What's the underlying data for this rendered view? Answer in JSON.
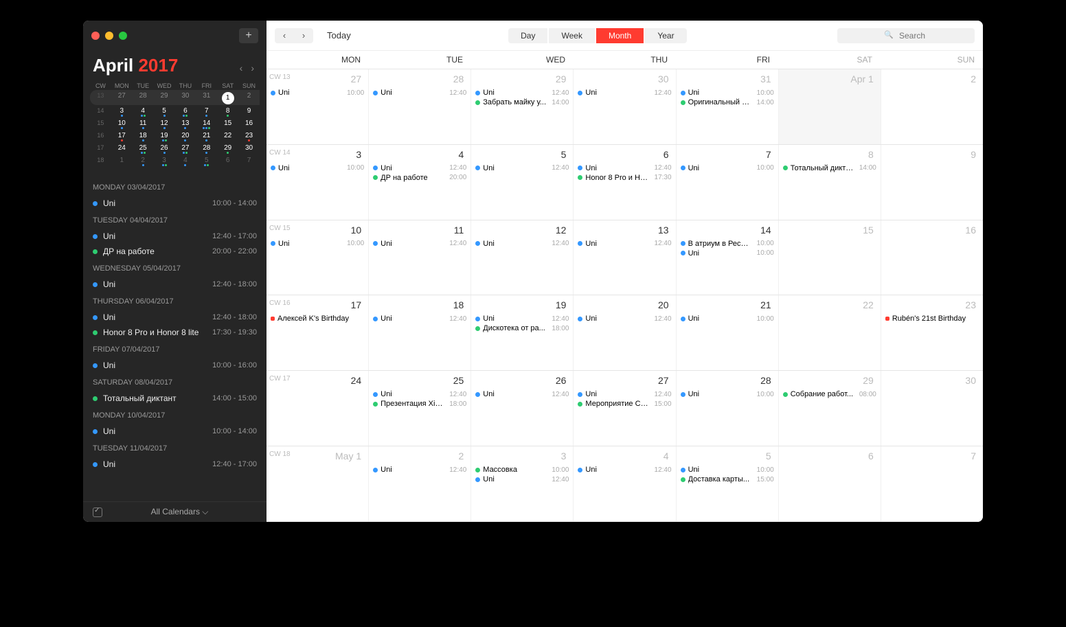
{
  "sidebar": {
    "month": "April",
    "year": "2017",
    "plus": "+",
    "dowHeaders": [
      "CW",
      "MON",
      "TUE",
      "WED",
      "THU",
      "FRI",
      "SAT",
      "SUN"
    ],
    "miniRows": [
      {
        "cw": "13",
        "days": [
          "27",
          "28",
          "29",
          "30",
          "31",
          "1",
          "2"
        ],
        "past": true,
        "todayIdx": 5
      },
      {
        "cw": "14",
        "days": [
          "3",
          "4",
          "5",
          "6",
          "7",
          "8",
          "9"
        ],
        "dots": [
          [
            "b"
          ],
          [
            "b",
            "g"
          ],
          [
            "b"
          ],
          [
            "b",
            "g"
          ],
          [
            "b"
          ],
          [
            "g"
          ],
          []
        ]
      },
      {
        "cw": "15",
        "days": [
          "10",
          "11",
          "12",
          "13",
          "14",
          "15",
          "16"
        ],
        "dots": [
          [
            "b"
          ],
          [
            "b"
          ],
          [
            "b"
          ],
          [
            "b"
          ],
          [
            "b",
            "b",
            "g"
          ],
          [],
          []
        ]
      },
      {
        "cw": "16",
        "days": [
          "17",
          "18",
          "19",
          "20",
          "21",
          "22",
          "23"
        ],
        "dots": [
          [
            "r"
          ],
          [
            "b"
          ],
          [
            "b",
            "g"
          ],
          [
            "b"
          ],
          [
            "b"
          ],
          [],
          [
            "r"
          ]
        ]
      },
      {
        "cw": "17",
        "days": [
          "24",
          "25",
          "26",
          "27",
          "28",
          "29",
          "30"
        ],
        "dots": [
          [],
          [
            "b",
            "g"
          ],
          [
            "b"
          ],
          [
            "b",
            "g"
          ],
          [
            "b"
          ],
          [
            "g"
          ],
          []
        ]
      },
      {
        "cw": "18",
        "days": [
          "1",
          "2",
          "3",
          "4",
          "5",
          "6",
          "7"
        ],
        "dim": true,
        "dots": [
          [],
          [
            "b"
          ],
          [
            "b",
            "g"
          ],
          [
            "b"
          ],
          [
            "b",
            "g"
          ],
          [],
          []
        ]
      }
    ],
    "agenda": [
      {
        "header": "MONDAY 03/04/2017"
      },
      {
        "dot": "#3498ff",
        "title": "Uni",
        "time": "10:00 - 14:00"
      },
      {
        "header": "TUESDAY 04/04/2017"
      },
      {
        "dot": "#3498ff",
        "title": "Uni",
        "time": "12:40 - 17:00"
      },
      {
        "dot": "#2ecc71",
        "title": "ДР на работе",
        "time": "20:00 - 22:00"
      },
      {
        "header": "WEDNESDAY 05/04/2017"
      },
      {
        "dot": "#3498ff",
        "title": "Uni",
        "time": "12:40 - 18:00"
      },
      {
        "header": "THURSDAY 06/04/2017"
      },
      {
        "dot": "#3498ff",
        "title": "Uni",
        "time": "12:40 - 18:00"
      },
      {
        "dot": "#2ecc71",
        "title": "Honor 8 Pro и Honor 8 lite",
        "time": "17:30 - 19:30"
      },
      {
        "header": "FRIDAY 07/04/2017"
      },
      {
        "dot": "#3498ff",
        "title": "Uni",
        "time": "10:00 - 16:00"
      },
      {
        "header": "SATURDAY 08/04/2017"
      },
      {
        "dot": "#2ecc71",
        "title": "Тотальный диктант",
        "time": "14:00 - 15:00"
      },
      {
        "header": "MONDAY 10/04/2017"
      },
      {
        "dot": "#3498ff",
        "title": "Uni",
        "time": "10:00 - 14:00"
      },
      {
        "header": "TUESDAY 11/04/2017"
      },
      {
        "dot": "#3498ff",
        "title": "Uni",
        "time": "12:40 - 17:00"
      }
    ],
    "footer": {
      "all": "All Calendars ⌵"
    }
  },
  "toolbar": {
    "prev": "‹",
    "next": "›",
    "today": "Today",
    "views": [
      "Day",
      "Week",
      "Month",
      "Year"
    ],
    "active": "Month",
    "searchPlaceholder": "Search"
  },
  "dow": [
    "MON",
    "TUE",
    "WED",
    "THU",
    "FRI",
    "SAT",
    "SUN"
  ],
  "weeks": [
    {
      "cw": "CW 13",
      "days": [
        {
          "n": "27",
          "dim": true,
          "events": [
            {
              "c": "#3498ff",
              "t": "Uni",
              "time": "10:00"
            }
          ]
        },
        {
          "n": "28",
          "dim": true,
          "events": [
            {
              "c": "#3498ff",
              "t": "Uni",
              "time": "12:40"
            }
          ]
        },
        {
          "n": "29",
          "dim": true,
          "events": [
            {
              "c": "#3498ff",
              "t": "Uni",
              "time": "12:40"
            },
            {
              "c": "#2ecc71",
              "t": "Забрать майку у...",
              "time": "14:00"
            }
          ]
        },
        {
          "n": "30",
          "dim": true,
          "events": [
            {
              "c": "#3498ff",
              "t": "Uni",
              "time": "12:40"
            }
          ]
        },
        {
          "n": "31",
          "dim": true,
          "events": [
            {
              "c": "#3498ff",
              "t": "Uni",
              "time": "10:00"
            },
            {
              "c": "#2ecc71",
              "t": "Оригинальный ч...",
              "time": "14:00"
            }
          ]
        },
        {
          "n": "Apr 1",
          "shade": true,
          "weekend": true,
          "events": []
        },
        {
          "n": "2",
          "weekend": true,
          "events": []
        }
      ]
    },
    {
      "cw": "CW 14",
      "days": [
        {
          "n": "3",
          "events": [
            {
              "c": "#3498ff",
              "t": "Uni",
              "time": "10:00"
            }
          ]
        },
        {
          "n": "4",
          "events": [
            {
              "c": "#3498ff",
              "t": "Uni",
              "time": "12:40"
            },
            {
              "c": "#2ecc71",
              "t": "ДР на работе",
              "time": "20:00"
            }
          ]
        },
        {
          "n": "5",
          "events": [
            {
              "c": "#3498ff",
              "t": "Uni",
              "time": "12:40"
            }
          ]
        },
        {
          "n": "6",
          "events": [
            {
              "c": "#3498ff",
              "t": "Uni",
              "time": "12:40"
            },
            {
              "c": "#2ecc71",
              "t": "Honor 8 Pro и Ho...",
              "time": "17:30"
            }
          ]
        },
        {
          "n": "7",
          "events": [
            {
              "c": "#3498ff",
              "t": "Uni",
              "time": "10:00"
            }
          ]
        },
        {
          "n": "8",
          "weekend": true,
          "events": [
            {
              "c": "#2ecc71",
              "t": "Тотальный дикта...",
              "time": "14:00"
            }
          ]
        },
        {
          "n": "9",
          "weekend": true,
          "events": []
        }
      ]
    },
    {
      "cw": "CW 15",
      "days": [
        {
          "n": "10",
          "events": [
            {
              "c": "#3498ff",
              "t": "Uni",
              "time": "10:00"
            }
          ]
        },
        {
          "n": "11",
          "events": [
            {
              "c": "#3498ff",
              "t": "Uni",
              "time": "12:40"
            }
          ]
        },
        {
          "n": "12",
          "events": [
            {
              "c": "#3498ff",
              "t": "Uni",
              "time": "12:40"
            }
          ]
        },
        {
          "n": "13",
          "events": [
            {
              "c": "#3498ff",
              "t": "Uni",
              "time": "12:40"
            }
          ]
        },
        {
          "n": "14",
          "events": [
            {
              "c": "#3498ff",
              "t": "В атриум в Рестор",
              "time": "10:00"
            },
            {
              "c": "#3498ff",
              "t": "Uni",
              "time": "10:00"
            }
          ]
        },
        {
          "n": "15",
          "weekend": true,
          "events": []
        },
        {
          "n": "16",
          "weekend": true,
          "events": []
        }
      ]
    },
    {
      "cw": "CW 16",
      "days": [
        {
          "n": "17",
          "events": [
            {
              "c": "#ff3b30",
              "t": "Алексей K's Birthday",
              "time": "",
              "sq": true
            }
          ]
        },
        {
          "n": "18",
          "events": [
            {
              "c": "#3498ff",
              "t": "Uni",
              "time": "12:40"
            }
          ]
        },
        {
          "n": "19",
          "events": [
            {
              "c": "#3498ff",
              "t": "Uni",
              "time": "12:40"
            },
            {
              "c": "#2ecc71",
              "t": "Дискотека от ра...",
              "time": "18:00"
            }
          ]
        },
        {
          "n": "20",
          "events": [
            {
              "c": "#3498ff",
              "t": "Uni",
              "time": "12:40"
            }
          ]
        },
        {
          "n": "21",
          "events": [
            {
              "c": "#3498ff",
              "t": "Uni",
              "time": "10:00"
            }
          ]
        },
        {
          "n": "22",
          "weekend": true,
          "events": []
        },
        {
          "n": "23",
          "weekend": true,
          "events": [
            {
              "c": "#ff3b30",
              "t": "Rubén's 21st Birthday",
              "time": "",
              "sq": true
            }
          ]
        }
      ]
    },
    {
      "cw": "CW 17",
      "days": [
        {
          "n": "24",
          "events": []
        },
        {
          "n": "25",
          "events": [
            {
              "c": "#3498ff",
              "t": "Uni",
              "time": "12:40"
            },
            {
              "c": "#2ecc71",
              "t": "Презентация Xia...",
              "time": "18:00"
            }
          ]
        },
        {
          "n": "26",
          "events": [
            {
              "c": "#3498ff",
              "t": "Uni",
              "time": "12:40"
            }
          ]
        },
        {
          "n": "27",
          "events": [
            {
              "c": "#3498ff",
              "t": "Uni",
              "time": "12:40"
            },
            {
              "c": "#2ecc71",
              "t": "Мероприятие Са...",
              "time": "15:00"
            }
          ]
        },
        {
          "n": "28",
          "events": [
            {
              "c": "#3498ff",
              "t": "Uni",
              "time": "10:00"
            }
          ]
        },
        {
          "n": "29",
          "weekend": true,
          "events": [
            {
              "c": "#2ecc71",
              "t": "Собрание работ...",
              "time": "08:00"
            }
          ]
        },
        {
          "n": "30",
          "weekend": true,
          "events": []
        }
      ]
    },
    {
      "cw": "CW 18",
      "days": [
        {
          "n": "May 1",
          "dim": true,
          "events": []
        },
        {
          "n": "2",
          "dim": true,
          "events": [
            {
              "c": "#3498ff",
              "t": "Uni",
              "time": "12:40"
            }
          ]
        },
        {
          "n": "3",
          "dim": true,
          "events": [
            {
              "c": "#2ecc71",
              "t": "Массовка",
              "time": "10:00"
            },
            {
              "c": "#3498ff",
              "t": "Uni",
              "time": "12:40"
            }
          ]
        },
        {
          "n": "4",
          "dim": true,
          "events": [
            {
              "c": "#3498ff",
              "t": "Uni",
              "time": "12:40"
            }
          ]
        },
        {
          "n": "5",
          "dim": true,
          "events": [
            {
              "c": "#3498ff",
              "t": "Uni",
              "time": "10:00"
            },
            {
              "c": "#2ecc71",
              "t": "Доставка карты...",
              "time": "15:00"
            }
          ]
        },
        {
          "n": "6",
          "dim": true,
          "weekend": true,
          "events": []
        },
        {
          "n": "7",
          "dim": true,
          "weekend": true,
          "events": []
        }
      ]
    }
  ]
}
